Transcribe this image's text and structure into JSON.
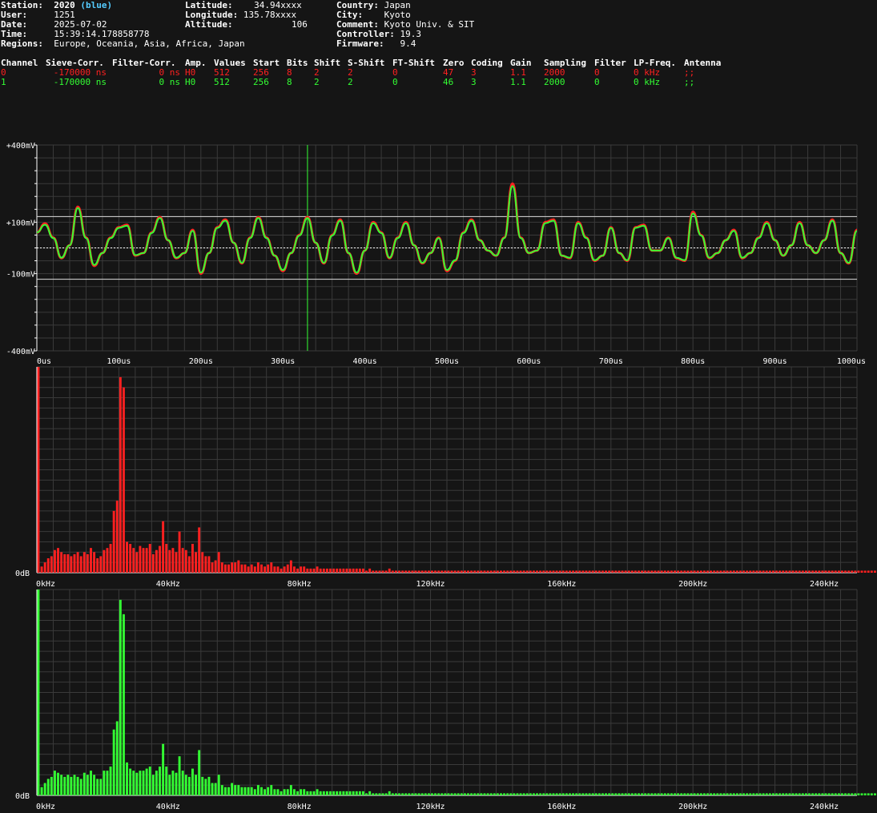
{
  "info": {
    "station_label": "Station:",
    "station": "2020",
    "station_color_name": "(blue)",
    "user_label": "User:",
    "user": "1251",
    "date_label": "Date:",
    "date": "2025-07-02",
    "time_label": "Time:",
    "time": "15:39:14.178858778",
    "regions_label": "Regions:",
    "regions": "Europe, Oceania, Asia, Africa, Japan",
    "lat_label": "Latitude:",
    "lat": "34.94xxxx",
    "lon_label": "Longitude:",
    "lon": "135.78xxxx",
    "alt_label": "Altitude:",
    "alt": "106",
    "country_label": "Country:",
    "country": "Japan",
    "city_label": "City:",
    "city": "Kyoto",
    "comment_label": "Comment:",
    "comment": "Kyoto Univ. & SIT",
    "controller_label": "Controller:",
    "controller": "19.3",
    "firmware_label": "Firmware:",
    "firmware": "9.4"
  },
  "channels": {
    "headers": [
      "Channel",
      "Sieve-Corr.",
      "Filter-Corr.",
      "Amp.",
      "Values",
      "Start",
      "Bits",
      "Shift",
      "S-Shift",
      "FT-Shift",
      "Zero",
      "Coding",
      "Gain",
      "Sampling",
      "Filter",
      "LP-Freq.",
      "Antenna"
    ],
    "rows": [
      {
        "color": "#ff2020",
        "cells": [
          "0",
          "-170000 ns",
          "0 ns",
          "H0",
          "512",
          "256",
          "8",
          "2",
          "2",
          "0",
          "47",
          "3",
          "1.1",
          "2000",
          "0",
          "0 kHz",
          ";;"
        ]
      },
      {
        "color": "#33ff33",
        "cells": [
          "1",
          "-170000 ns",
          "0 ns",
          "H0",
          "512",
          "256",
          "8",
          "2",
          "2",
          "0",
          "46",
          "3",
          "1.1",
          "2000",
          "0",
          "0 kHz",
          ";;"
        ]
      }
    ]
  },
  "colors": {
    "ch0": "#ff2020",
    "ch1": "#33ff33",
    "grid": "#3a3a3a",
    "background": "#151515"
  },
  "waveform": {
    "y_labels": [
      "+400mV",
      "+100mV",
      "-100mV",
      "-400mV"
    ],
    "x_labels": [
      "0us",
      "100us",
      "200us",
      "300us",
      "400us",
      "500us",
      "600us",
      "700us",
      "800us",
      "900us",
      "1000us"
    ],
    "cursor_us": 330,
    "chart_data": {
      "type": "line",
      "xlim": [
        0,
        1000
      ],
      "ylim": [
        -400,
        400
      ],
      "xunit": "us",
      "yunit": "mV",
      "series": [
        {
          "x": [
            0,
            10,
            20,
            30,
            40,
            50,
            60,
            70,
            80,
            90,
            100,
            110,
            120,
            130,
            140,
            150,
            160,
            170,
            180,
            190,
            200,
            210,
            220,
            230,
            240,
            250,
            260,
            270,
            280,
            290,
            300,
            310,
            320,
            330,
            340,
            350,
            360,
            370,
            380,
            390,
            400,
            410,
            420,
            430,
            440,
            450,
            460,
            470,
            480,
            490,
            500,
            510,
            520,
            530,
            540,
            550,
            560,
            570,
            580,
            590,
            600,
            610,
            620,
            630,
            640,
            650,
            660,
            670,
            680,
            690,
            700,
            710,
            720,
            730,
            740,
            750,
            760,
            770,
            780,
            790,
            800,
            810,
            820,
            830,
            840,
            850,
            860,
            870,
            880,
            890,
            900,
            910,
            920,
            930,
            940,
            950,
            960,
            970,
            980,
            990,
            1000
          ],
          "y": [
            60,
            95,
            40,
            -40,
            10,
            160,
            40,
            -70,
            -20,
            40,
            80,
            90,
            -30,
            -20,
            60,
            120,
            30,
            -40,
            -20,
            70,
            -100,
            -20,
            80,
            110,
            20,
            -60,
            40,
            120,
            40,
            -30,
            -90,
            -20,
            50,
            120,
            20,
            -60,
            50,
            110,
            -20,
            -100,
            -10,
            100,
            60,
            -40,
            40,
            100,
            10,
            -60,
            -20,
            40,
            -90,
            -50,
            60,
            110,
            30,
            -10,
            -30,
            40,
            250,
            40,
            -20,
            -10,
            100,
            110,
            -30,
            -40,
            100,
            40,
            -50,
            -30,
            80,
            -20,
            -50,
            80,
            90,
            -10,
            -10,
            40,
            -40,
            -50,
            140,
            50,
            -40,
            -20,
            30,
            70,
            -40,
            -20,
            40,
            100,
            30,
            -30,
            10,
            100,
            10,
            -20,
            30,
            110,
            -20,
            -60,
            70
          ]
        },
        {
          "x": [
            0,
            10,
            20,
            30,
            40,
            50,
            60,
            70,
            80,
            90,
            100,
            110,
            120,
            130,
            140,
            150,
            160,
            170,
            180,
            190,
            200,
            210,
            220,
            230,
            240,
            250,
            260,
            270,
            280,
            290,
            300,
            310,
            320,
            330,
            340,
            350,
            360,
            370,
            380,
            390,
            400,
            410,
            420,
            430,
            440,
            450,
            460,
            470,
            480,
            490,
            500,
            510,
            520,
            530,
            540,
            550,
            560,
            570,
            580,
            590,
            600,
            610,
            620,
            630,
            640,
            650,
            660,
            670,
            680,
            690,
            700,
            710,
            720,
            730,
            740,
            750,
            760,
            770,
            780,
            790,
            800,
            810,
            820,
            830,
            840,
            850,
            860,
            870,
            880,
            890,
            900,
            910,
            920,
            930,
            940,
            950,
            960,
            970,
            980,
            990,
            1000
          ],
          "y": [
            60,
            90,
            38,
            -38,
            10,
            155,
            38,
            -66,
            -20,
            38,
            78,
            86,
            -28,
            -20,
            58,
            116,
            30,
            -38,
            -20,
            66,
            -96,
            -20,
            78,
            106,
            20,
            -58,
            38,
            116,
            38,
            -30,
            -86,
            -20,
            48,
            116,
            20,
            -58,
            48,
            106,
            -20,
            -96,
            -10,
            96,
            58,
            -38,
            38,
            96,
            10,
            -58,
            -20,
            38,
            -86,
            -48,
            58,
            106,
            30,
            -10,
            -30,
            38,
            240,
            38,
            -20,
            -10,
            96,
            106,
            -30,
            -38,
            96,
            38,
            -48,
            -30,
            78,
            -20,
            -48,
            78,
            86,
            -10,
            -10,
            38,
            -38,
            -48,
            134,
            48,
            -38,
            -20,
            30,
            66,
            -38,
            -20,
            38,
            96,
            30,
            -30,
            10,
            96,
            10,
            -20,
            30,
            106,
            -20,
            -58,
            66
          ]
        }
      ]
    }
  },
  "spectrum": {
    "x_labels": [
      "0kHz",
      "40kHz",
      "80kHz",
      "120kHz",
      "160kHz",
      "200kHz",
      "240kHz"
    ],
    "y_label": "0dB",
    "xlim_khz": [
      0,
      250
    ],
    "chart_data": {
      "type": "bar",
      "bin_khz": 1,
      "series": [
        {
          "name": "ch0",
          "values": [
            100,
            3,
            5,
            7,
            8,
            11,
            12,
            10,
            9,
            9,
            8,
            9,
            10,
            8,
            10,
            9,
            12,
            10,
            7,
            8,
            11,
            12,
            14,
            30,
            35,
            95,
            90,
            15,
            14,
            12,
            10,
            13,
            12,
            12,
            14,
            9,
            11,
            13,
            25,
            14,
            11,
            12,
            10,
            20,
            12,
            11,
            8,
            14,
            10,
            22,
            10,
            8,
            8,
            5,
            6,
            10,
            5,
            4,
            4,
            5,
            5,
            6,
            4,
            4,
            3,
            4,
            3,
            5,
            4,
            3,
            4,
            5,
            3,
            3,
            2,
            3,
            4,
            6,
            3,
            2,
            3,
            3,
            2,
            2,
            2,
            3,
            2,
            2,
            2,
            2,
            2,
            2,
            2,
            2,
            2,
            2,
            2,
            2,
            2,
            2,
            1,
            2,
            1,
            1,
            1,
            1,
            1,
            2,
            1,
            1,
            1,
            1,
            1,
            1,
            1,
            1,
            1,
            1,
            1,
            1,
            1,
            1,
            1,
            1,
            1,
            1,
            1,
            1,
            1,
            1,
            1,
            1,
            1,
            1,
            1,
            1,
            1,
            1,
            1,
            1,
            1,
            1,
            1,
            1,
            1,
            1,
            1,
            1,
            1,
            1,
            1,
            1,
            1,
            1,
            1,
            1,
            1,
            1,
            1,
            1,
            1,
            1,
            1,
            1,
            1,
            1,
            1,
            1,
            1,
            1,
            1,
            1,
            1,
            1,
            1,
            1,
            1,
            1,
            1,
            1,
            1,
            1,
            1,
            1,
            1,
            1,
            1,
            1,
            1,
            1,
            1,
            1,
            1,
            1,
            1,
            1,
            1,
            1,
            1,
            1,
            1,
            1,
            1,
            1,
            1,
            1,
            1,
            1,
            1,
            1,
            1,
            1,
            1,
            1,
            1,
            1,
            1,
            1,
            1,
            1,
            1,
            1,
            1,
            1,
            1,
            1,
            1,
            1,
            1,
            1,
            1,
            1,
            1,
            1,
            1,
            1,
            1,
            1,
            1,
            1,
            1,
            1,
            1,
            1,
            1,
            1,
            1,
            1,
            1,
            1,
            1,
            1,
            1,
            1,
            1,
            1,
            1,
            1,
            1,
            1
          ]
        },
        {
          "name": "ch1",
          "values": [
            100,
            4,
            6,
            8,
            9,
            12,
            11,
            10,
            9,
            10,
            9,
            10,
            9,
            8,
            11,
            10,
            12,
            10,
            8,
            8,
            12,
            12,
            14,
            32,
            36,
            95,
            88,
            16,
            13,
            12,
            11,
            12,
            12,
            13,
            14,
            10,
            12,
            14,
            25,
            14,
            10,
            12,
            11,
            19,
            12,
            10,
            9,
            13,
            10,
            22,
            9,
            8,
            9,
            6,
            6,
            10,
            5,
            4,
            4,
            6,
            5,
            5,
            4,
            4,
            4,
            4,
            3,
            5,
            4,
            3,
            4,
            5,
            3,
            3,
            2,
            3,
            3,
            5,
            3,
            2,
            3,
            3,
            2,
            2,
            2,
            3,
            2,
            2,
            2,
            2,
            2,
            2,
            2,
            2,
            2,
            2,
            2,
            2,
            2,
            2,
            1,
            2,
            1,
            1,
            1,
            1,
            1,
            2,
            1,
            1,
            1,
            1,
            1,
            1,
            1,
            1,
            1,
            1,
            1,
            1,
            1,
            1,
            1,
            1,
            1,
            1,
            1,
            1,
            1,
            1,
            1,
            1,
            1,
            1,
            1,
            1,
            1,
            1,
            1,
            1,
            1,
            1,
            1,
            1,
            1,
            1,
            1,
            1,
            1,
            1,
            1,
            1,
            1,
            1,
            1,
            1,
            1,
            1,
            1,
            1,
            1,
            1,
            1,
            1,
            1,
            1,
            1,
            1,
            1,
            1,
            1,
            1,
            1,
            1,
            1,
            1,
            1,
            1,
            1,
            1,
            1,
            1,
            1,
            1,
            1,
            1,
            1,
            1,
            1,
            1,
            1,
            1,
            1,
            1,
            1,
            1,
            1,
            1,
            1,
            1,
            1,
            1,
            1,
            1,
            1,
            1,
            1,
            1,
            1,
            1,
            1,
            1,
            1,
            1,
            1,
            1,
            1,
            1,
            1,
            1,
            1,
            1,
            1,
            1,
            1,
            1,
            1,
            1,
            1,
            1,
            1,
            1,
            1,
            1,
            1,
            1,
            1,
            1,
            1,
            1,
            1,
            1,
            1,
            1,
            1,
            1,
            1,
            1,
            1,
            1,
            1,
            1,
            1,
            1,
            1,
            1,
            1,
            1,
            1,
            1,
            1
          ]
        }
      ]
    }
  }
}
